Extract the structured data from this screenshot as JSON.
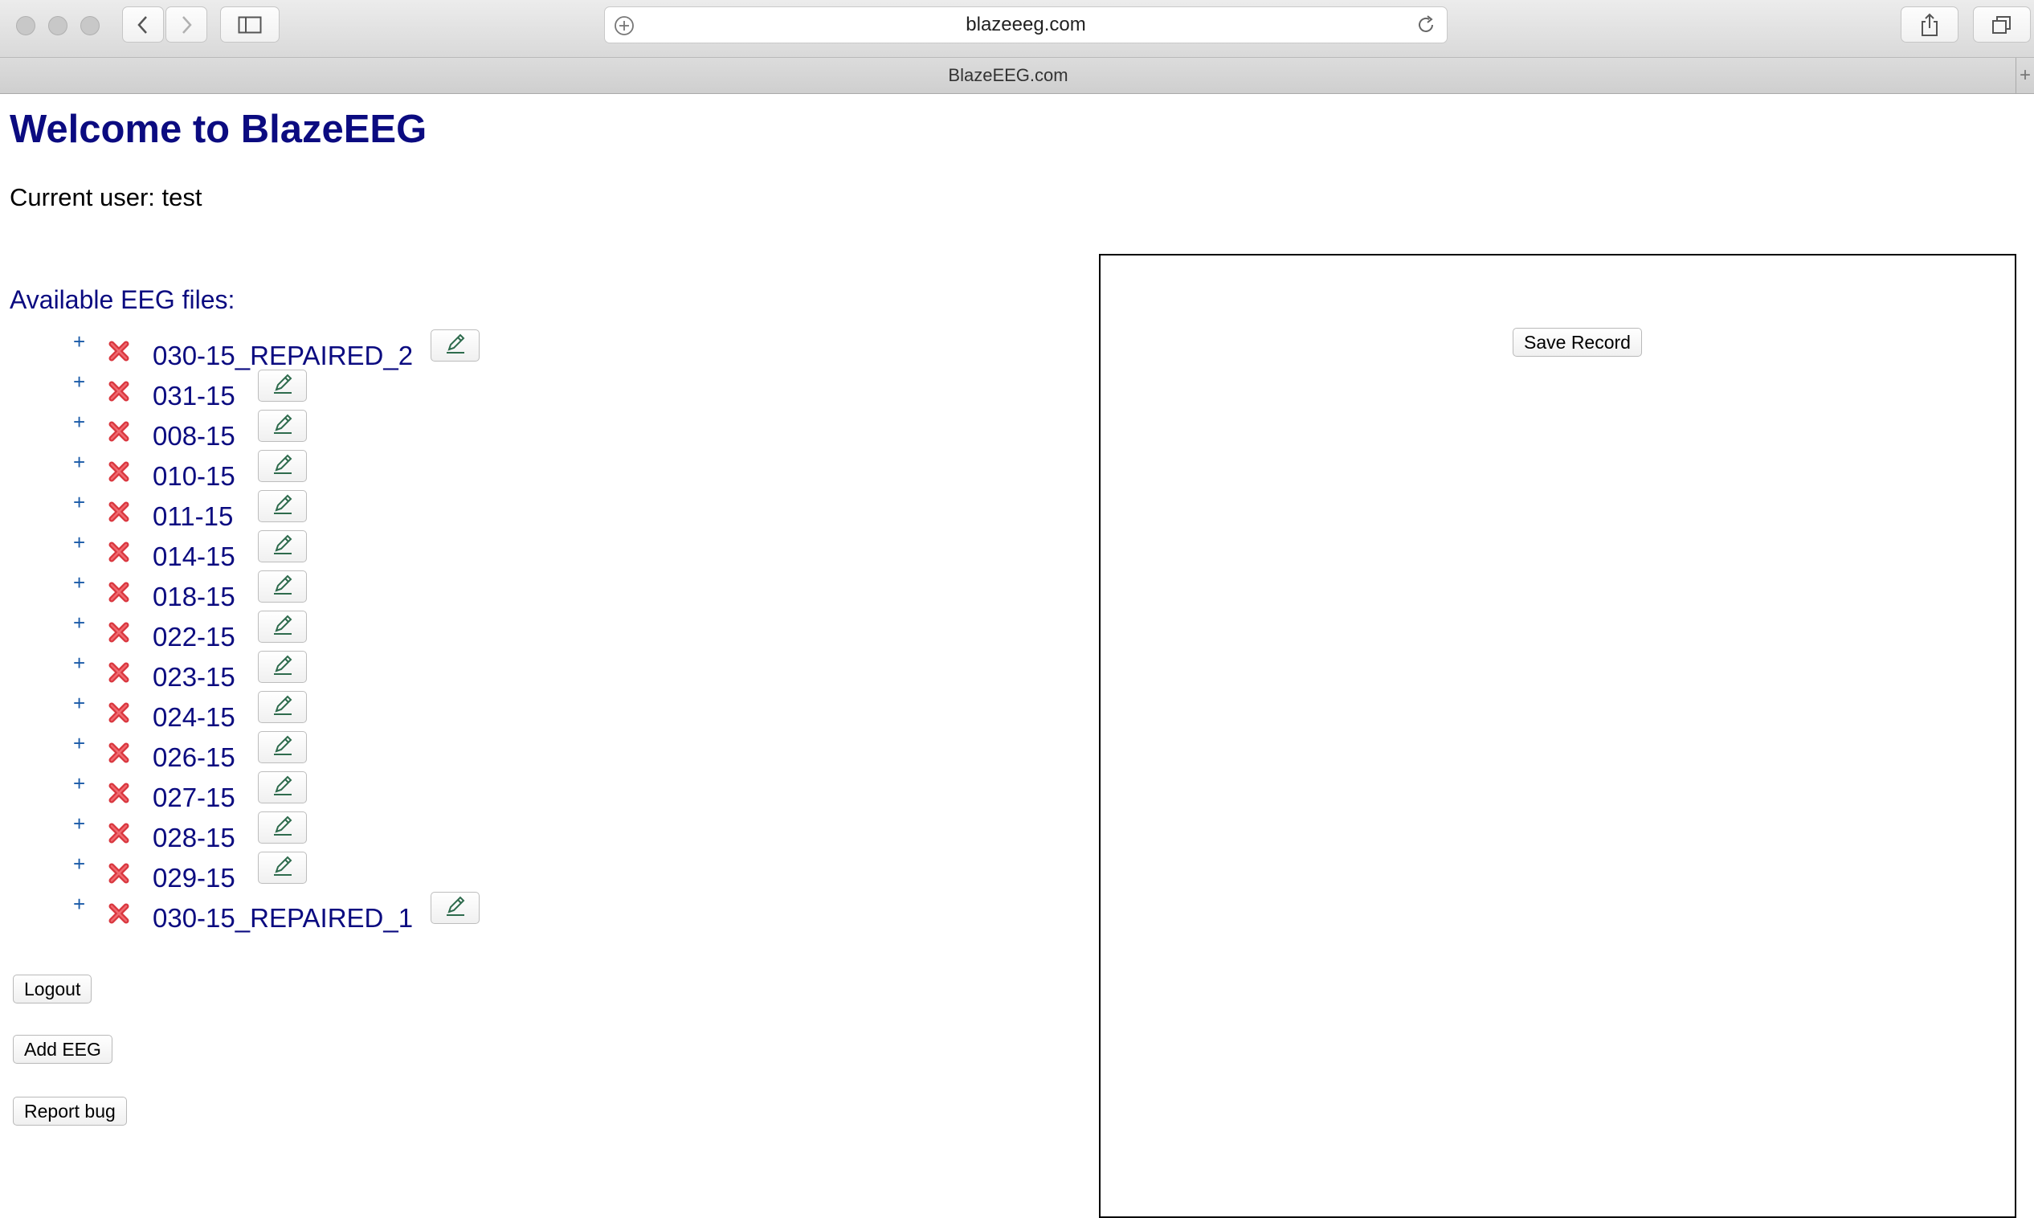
{
  "browser": {
    "url": "blazeeeg.com",
    "tab_title": "BlazeEEG.com",
    "tab_add_symbol": "+"
  },
  "page": {
    "title": "Welcome to BlazeEEG",
    "current_user": "Current user: test",
    "files_heading": "Available EEG files:",
    "expand_symbol": "+",
    "files": [
      {
        "name": "030-15_REPAIRED_2"
      },
      {
        "name": "031-15"
      },
      {
        "name": "008-15"
      },
      {
        "name": "010-15"
      },
      {
        "name": "011-15"
      },
      {
        "name": "014-15"
      },
      {
        "name": "018-15"
      },
      {
        "name": "022-15"
      },
      {
        "name": "023-15"
      },
      {
        "name": "024-15"
      },
      {
        "name": "026-15"
      },
      {
        "name": "027-15"
      },
      {
        "name": "028-15"
      },
      {
        "name": "029-15"
      },
      {
        "name": "030-15_REPAIRED_1"
      }
    ],
    "buttons": {
      "logout": "Logout",
      "add_eeg": "Add EEG",
      "report_bug": "Report bug"
    },
    "record_panel": {
      "save_label": "Save Record"
    }
  },
  "colors": {
    "heading": "#0b0b80",
    "delete_icon": "#d9363e",
    "expand_icon": "#1a5aa8"
  }
}
